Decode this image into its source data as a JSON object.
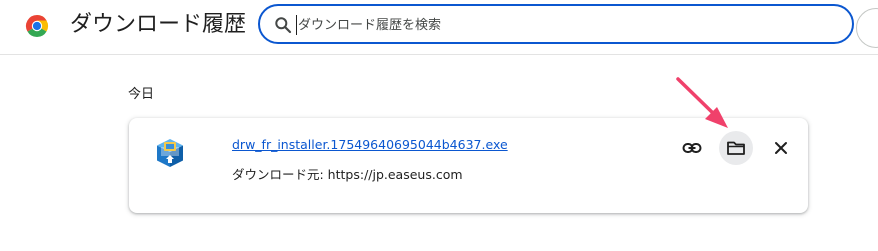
{
  "header": {
    "title": "ダウンロード履歴",
    "logo_icon": "chrome-logo-icon",
    "search": {
      "value": "",
      "placeholder": "ダウンロード履歴を検索",
      "icon": "search-icon"
    }
  },
  "groups": [
    {
      "date_label": "今日",
      "items": [
        {
          "file_name": "drw_fr_installer.17549640695044b4637.exe",
          "source": "ダウンロード元: https://jp.easeus.com",
          "file_icon": "installer-file-icon",
          "actions": [
            {
              "name": "copy-link",
              "icon": "link-icon"
            },
            {
              "name": "show-in-folder",
              "icon": "folder-icon"
            },
            {
              "name": "remove",
              "icon": "close-icon"
            }
          ]
        }
      ]
    }
  ],
  "colors": {
    "accent": "#0b57d0",
    "annotation_arrow": "#f0416b",
    "folder_button_bg": "#e9eaec"
  }
}
